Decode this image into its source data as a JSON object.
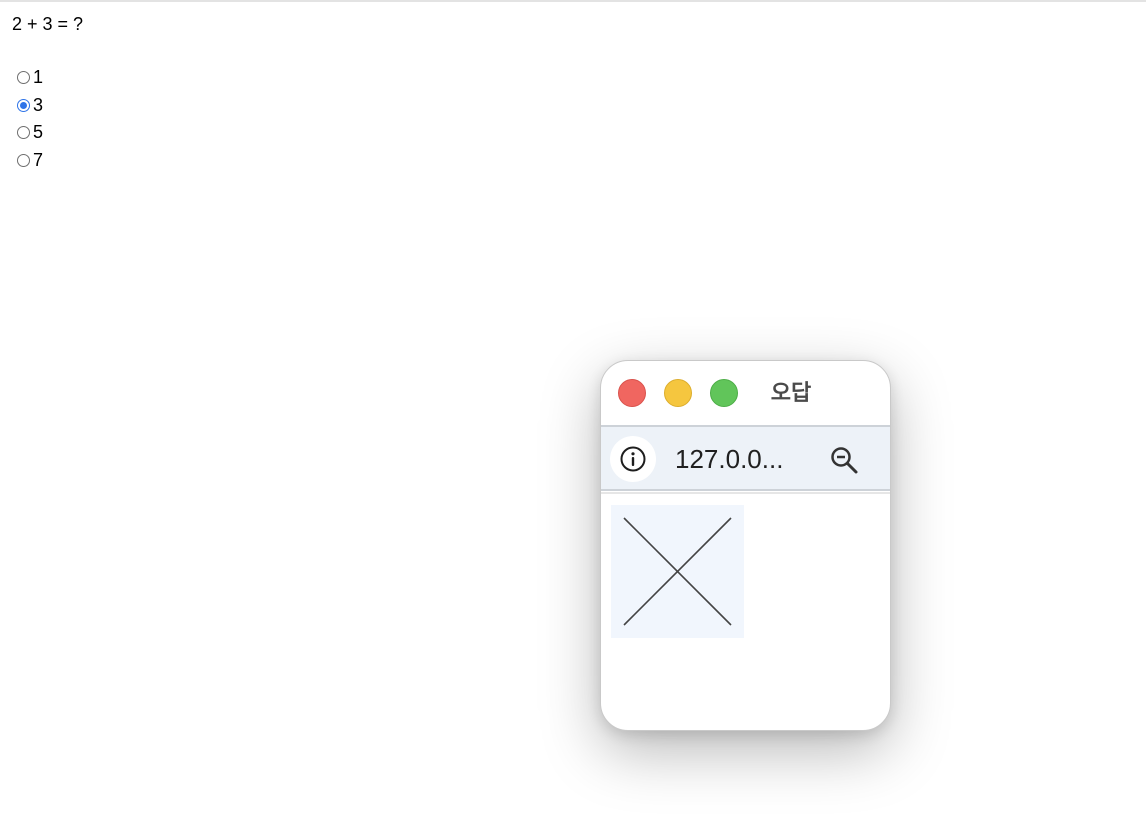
{
  "question": {
    "text": "2 + 3 = ?"
  },
  "options": [
    {
      "label": "1",
      "checked": false
    },
    {
      "label": "3",
      "checked": true
    },
    {
      "label": "5",
      "checked": false
    },
    {
      "label": "7",
      "checked": false
    }
  ],
  "popup": {
    "title": "오답",
    "url": "127.0.0...",
    "icons": {
      "info": "info-icon",
      "zoom": "zoom-out-icon",
      "image": "broken-image-icon"
    }
  },
  "colors": {
    "radio_accent": "#2f74e8",
    "close": "#f06660",
    "minimize": "#f5c63f",
    "maximize": "#61c55a",
    "url_bar": "#edf2f8"
  }
}
